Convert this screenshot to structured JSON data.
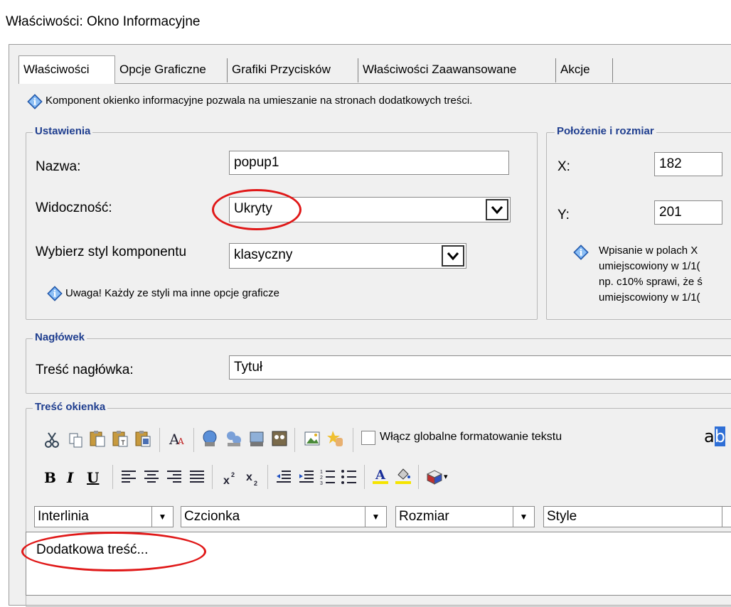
{
  "window": {
    "title": "Właściwości: Okno Informacyjne"
  },
  "tabs": [
    {
      "label": "Właściwości",
      "active": true
    },
    {
      "label": "Opcje Graficzne"
    },
    {
      "label": "Grafiki Przycisków"
    },
    {
      "label": "Właściwości Zaawansowane"
    },
    {
      "label": "Akcje"
    }
  ],
  "intro": {
    "text": "Komponent okienko informacyjne pozwala na umieszanie na stronach dodatkowych treści.",
    "icon": "info-icon"
  },
  "settings": {
    "legend": "Ustawienia",
    "name_label": "Nazwa:",
    "name_value": "popup1",
    "visibility_label": "Widoczność:",
    "visibility_value": "Ukryty",
    "style_label": "Wybierz styl komponentu",
    "style_value": "klasyczny",
    "note": "Uwaga! Każdy ze styli ma inne opcje graficze"
  },
  "position": {
    "legend": "Położenie i rozmiar",
    "x_label": "X:",
    "x_value": "182",
    "y_label": "Y:",
    "y_value": "201",
    "note_lines": [
      "Wpisanie w polach X",
      "umiejscowiony w 1/1(",
      "np. c10% sprawi, że ś",
      "umiejscowiony w 1/1("
    ]
  },
  "header": {
    "legend": "Nagłówek",
    "content_label": "Treść nagłówka:",
    "content_value": "Tytuł"
  },
  "body": {
    "legend": "Treść okienka",
    "global_format_label": "Włącz globalne formatowanie tekstu",
    "global_format_checked": false,
    "fmt": {
      "bold": "B",
      "italic": "I",
      "underline": "U"
    },
    "line_spacing": "Interlinia",
    "font": "Czcionka",
    "size": "Rozmiar",
    "style": "Style",
    "editor_text": "Dodatkowa treść..."
  },
  "colors": {
    "legend": "#1f3e8f",
    "highlight": "#e01818",
    "panel": "#f0f0f0"
  }
}
